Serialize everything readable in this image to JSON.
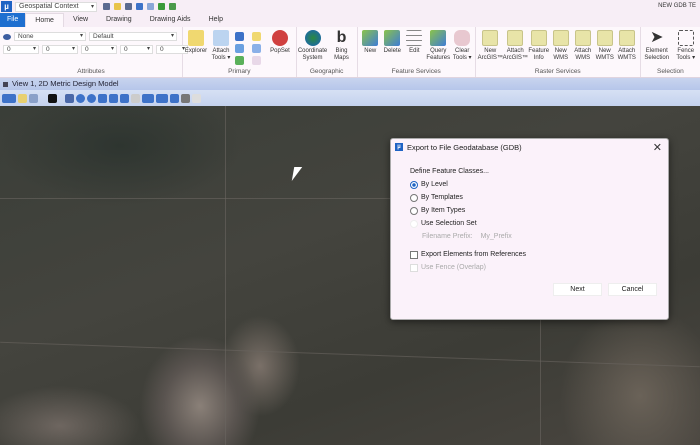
{
  "app": {
    "title": "NEW GDB TE",
    "context": "Geospatial Context"
  },
  "tabs": [
    "File",
    "Home",
    "View",
    "Drawing",
    "Drawing Aids",
    "Help"
  ],
  "ribbon": {
    "attributes": {
      "label": "Attributes",
      "level": "None",
      "style": "Default",
      "values": [
        "0",
        "0",
        "0",
        "0",
        "0"
      ]
    },
    "primary": {
      "label": "Primary",
      "buttons": [
        "Explorer",
        "Attach Tools ▾",
        "PopSet"
      ]
    },
    "geographic": {
      "label": "Geographic",
      "buttons": [
        "Coordinate System",
        "Bing Maps"
      ]
    },
    "feature_services": {
      "label": "Feature Services",
      "buttons": [
        "New",
        "Delete",
        "Edit",
        "Query Features",
        "Clear Tools ▾"
      ]
    },
    "raster_services": {
      "label": "Raster Services",
      "buttons": [
        "New ArcGIS™",
        "Attach ArcGIS™",
        "Feature Info",
        "New WMS",
        "Attach WMS",
        "New WMTS",
        "Attach WMTS"
      ]
    },
    "selection": {
      "label": "Selection",
      "buttons": [
        "Element Selection",
        "Fence Tools ▾"
      ]
    }
  },
  "view": {
    "title": "View 1, 2D Metric Design Model"
  },
  "dialog": {
    "title": "Export to File Geodatabase (GDB)",
    "section": "Define Feature Classes...",
    "options": [
      {
        "label": "By Level",
        "selected": true
      },
      {
        "label": "By Templates",
        "selected": false
      },
      {
        "label": "By Item Types",
        "selected": false
      },
      {
        "label": "Use Selection Set",
        "selected": false
      }
    ],
    "prefix_label": "Filename Prefix:",
    "prefix_value": "My_Prefix",
    "export_refs": {
      "label": "Export Elements from References",
      "checked": false
    },
    "use_fence": {
      "label": "Use Fence (Overlap)",
      "checked": false
    },
    "next": "Next",
    "cancel": "Cancel"
  },
  "colors": {
    "accent": "#1e63c4",
    "ribbon_bg": "#fdf8fc",
    "view_bar": "#c4d2ee"
  }
}
